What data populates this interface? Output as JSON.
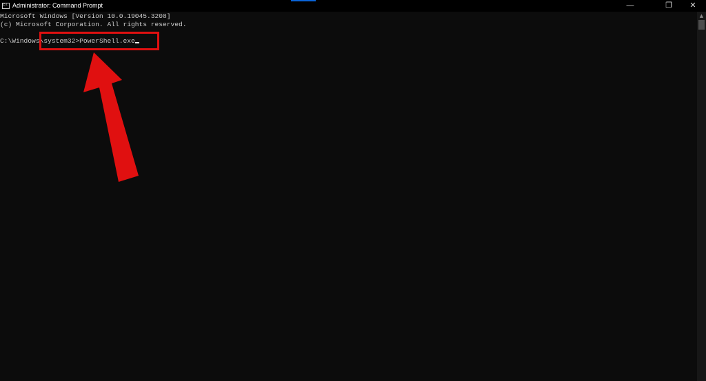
{
  "window": {
    "title": "Administrator: Command Prompt",
    "icon": "cmd-icon"
  },
  "controls": {
    "minimize": "—",
    "restore": "❐",
    "close": "✕"
  },
  "console": {
    "lines": [
      "Microsoft Windows [Version 10.0.19045.3208]",
      "(c) Microsoft Corporation. All rights reserved.",
      ""
    ],
    "prompt": "C:\\Windows\\system32>",
    "command": "PowerShell.exe"
  },
  "annotation": {
    "color": "#e01010"
  }
}
